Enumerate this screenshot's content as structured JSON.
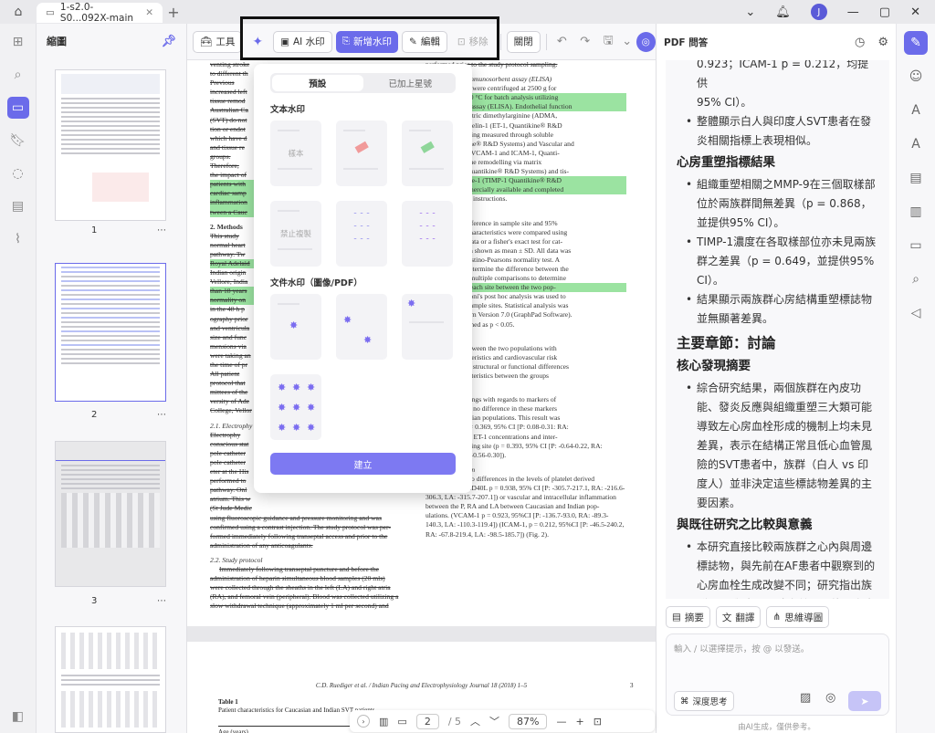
{
  "window": {
    "tab_title": "1-s2.0-S0...092X-main"
  },
  "thumbnails": {
    "title": "縮圖",
    "pages": [
      "1",
      "2",
      "3"
    ]
  },
  "toolbar": {
    "tool": "工具",
    "ai_watermark": "AI 水印",
    "add_watermark": "新增水印",
    "edit": "編輯",
    "remove": "移除",
    "close": "關閉"
  },
  "watermark_panel": {
    "tab_preset": "預設",
    "tab_starred": "已加上星號",
    "text_section": "文本水印",
    "file_section": "文件水印（圖像/PDF）",
    "card_labels": [
      "樣本",
      "",
      "",
      "禁止複製",
      "",
      ""
    ],
    "create": "建立"
  },
  "doc": {
    "left_lines": [
      "venting stroke",
      "to different th",
      "Previous",
      "increased left",
      "tissue remod",
      "Australian Ca",
      "(SVT) do not",
      "tion or endot",
      "which have d",
      "and tissue re",
      "groups.",
      "Therefore,",
      "the impact of",
      "patients with",
      "cardiac samp",
      "inflammation",
      "tween a Cauc"
    ],
    "methods_head": "2. Methods",
    "methods_lines": [
      "This study",
      "normal heart",
      "pathway. Tw",
      "Royal Adelaid",
      "Indian origin",
      "Vellore, India",
      "than 18 years",
      "normality on",
      "in the 48 h p",
      "ography prior",
      "and ventricula",
      "size and func",
      "mensions via",
      "were taking an",
      "the time of pr",
      "All patient",
      "protocol that",
      "mittees of the",
      "versity of Ade",
      "College, Vellor"
    ],
    "electro_head": "2.1. Electrophy",
    "electro_lines": [
      "Electrophy",
      "conscious stat",
      "pole catheter",
      "pole catheter",
      "eter at the His",
      "performed to",
      "pathway. Onl",
      "atrium. This w",
      "(St Jude Medic",
      "using fluoroscopic guidance and pressure monitoring and was",
      "confirmed using a contrast injection. The study protocol was per-",
      "formed immediately following transeptal access and prior to the",
      "administration of any anticoagulants."
    ],
    "study_head": "2.2. Study protocol",
    "study_lines": [
      "Immediately following transeptal puncture and before the",
      "administration of heparin simultaneous blood samples (20 mls)",
      "were collected through the sheaths in the left (LA) and right atria",
      "(RA), and femoral vein (peripheral). Blood was collected utilizing a",
      "slow withdrawal technique (approximately 1 ml per second) and"
    ],
    "right_top": "performed prior to the study protocol sampling.",
    "right_elisa": "enzyme-linked immunosorbent assay (ELISA)",
    "right_elisa_lines": [
      "d blood samples were centrifuged at 2500 g for",
      "and stored at −80 °C for batch analysis utilizing",
      "immunosorbent assay (ELISA). Endothelial function",
      "through asymmetric dimethylarginine (ADMA,",
      "ik®) and Endothelin-1 (ET-1, Quantikine® R&D",
      "inflammation being measured through soluble",
      "D40L, Quantikine® R&D Systems) and Vascular and",
      "sion molecules (VCAM-1 and ICAM-1, Quanti-",
      "ystems) and tissue remodelling via matrix",
      "se-9 (MMP-9, Quantikine® R&D Systems) and tis-",
      "metalloproteinase-1 (TIMP-1 Quantikine® R&D",
      "ISAs were commercially available and completed",
      "e manufacturer's instructions."
    ],
    "right_analysis": "nalysis",
    "right_analysis_lines": [
      "own as mean difference in sample site and 95%",
      "nmals. Patient characteristics were compared using",
      "for continuous data or a fisher's exact test for cat-",
      "l categorical data shown as mean ± SD. All data was",
      "ality by a D'Agostino-Pearsons normality test. A",
      "A was used to determine the difference between the",
      ", with a Tukeys multiple comparisons to determine",
      "of the means of each site between the two pop-",
      "opriate, Bonferroni's post hoc analysis was used to",
      "f the matching sample sites. Statistical analysis was",
      "g GraphPad Prism Version 7.0 (GraphPad Software).",
      "ficance was defined as p < 0.05."
    ],
    "right_char": "racteristics",
    "right_char_lines": [
      "o differences between the two populations with",
      "ographic characteristics and cardiovascular risk",
      "). There were no structural or functional differences",
      "iographic characteristics between the groups"
    ],
    "right_func": "function",
    "right_func_lines": [
      "nstrates the findings with regards to markers of",
      "ction. There was no difference in these markers",
      "aucasian and Indian populations. This result was",
      "both ADMA (p = 0.369, 95% CI [P: 0.08-0.31: RA:",
      "0.11-0.028]) and ET-1 concentrations and inter-",
      "pective of sampling site (p = 0.393, 95% CI [P: -0.64-0.22, RA:",
      "-0.51-0.35, LA: -0.56-0.30])."
    ],
    "inflam_head": "3.3. Inflammation",
    "inflam_lines": [
      "There were no differences in the levels of platelet derived",
      "inflammation (CD40L p = 0.938, 95% CI [P: -305.7-217.1, RA: -216.6-",
      "306.3, LA: -315.7-207.1]) or vascular and intracellular inflammation",
      "between the P, RA and LA between Caucasian and Indian pop-",
      "ulations. (VCAM-1 p = 0.923, 95%CI [P: -136.7-93.0, RA: -89.3-",
      "140.3, LA: -110.3-119.4]) (ICAM-1, p = 0.212, 95%CI [P: -46.5-240.2,",
      "RA: -67.8-219.4, LA: -98.5-185.7]) (Fig. 2)."
    ],
    "page2_header": "C.D. Ruediger et al. / Indian Pacing and Electrophysiology Journal 18 (2018) 1–5",
    "page2_pn": "3",
    "table_title": "Table 1",
    "table_caption": "Patient characteristics for Caucasian and Indian SVT patients.",
    "table_row": "Age (years)"
  },
  "bottom": {
    "page": "2",
    "total": "/ 5",
    "zoom": "87%"
  },
  "ai_panel": {
    "title": "PDF 問答",
    "lines": [
      "0.923；ICAM-1 p = 0.212，均提供",
      "95% CI）。"
    ],
    "b_top": "整體顯示白人與印度人SVT患者在發炎相關指標上表現相似。",
    "h_cardiac": "心房重塑指標結果",
    "cardiac": [
      "組織重塑相關之MMP-9在三個取樣部位於兩族群間無差異（p = 0.868，並提供95% CI）。",
      "TIMP-1濃度在各取樣部位亦未見兩族群之差異（p = 0.649，並提供95% CI）。",
      "結果顯示兩族群心房結構重塑標誌物並無顯著差異。"
    ],
    "h_main": "主要章節：討論",
    "h_core": "核心發現摘要",
    "core": [
      "綜合研究結果，兩個族群在內皮功能、發炎反應與組織重塑三大類可能導致左心房血栓形成的機制上均未見差異，表示在結構正常且低心血管風險的SVT患者中，族群（白人 vs 印度人）並非決定這些標誌物差異的主要因素。"
    ],
    "h_compare": "與既往研究之比較與意義",
    "compare": [
      "本研究直接比較兩族群之心內與周邊標誌物，與先前在AF患者中觀察到的心房血栓生成改變不同；研究指出族群間AF與中風風險之差異可能更多由共病（如高血壓、糖尿病等）或其他因素所致，而非純族群差異導致的內皮或凝血機制改變。"
    ],
    "btn_summary": "摘要",
    "btn_translate": "翻譯",
    "btn_mindmap": "思維導圖",
    "input_placeholder": "輸入 / 以選擇提示，按 @ 以發送。",
    "deep_think": "深度思考",
    "footer": "由AI生成，僅供參考。"
  }
}
